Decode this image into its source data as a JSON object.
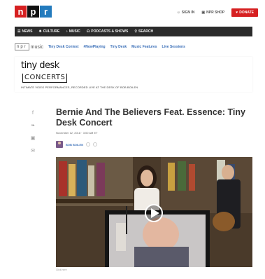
{
  "header": {
    "logo": [
      "n",
      "p",
      "r"
    ],
    "links": [
      {
        "label": "SIGN IN",
        "icon": "user-icon"
      },
      {
        "label": "NPR SHOP",
        "icon": "shop-icon"
      }
    ],
    "donate_label": "DONATE"
  },
  "nav": {
    "items": [
      {
        "label": "NEWS",
        "icon": "menu-icon"
      },
      {
        "label": "CULTURE",
        "icon": "culture-icon"
      },
      {
        "label": "MUSIC",
        "icon": "music-icon"
      },
      {
        "label": "PODCASTS & SHOWS",
        "icon": "headphones-icon"
      },
      {
        "label": "SEARCH",
        "icon": "search-icon"
      }
    ]
  },
  "music_bar": {
    "logo_npr": "npr",
    "logo_music": "music",
    "links": [
      "Tiny Desk Contest",
      "#NowPlaying",
      "Tiny Desk",
      "Music Features",
      "Live Sessions"
    ]
  },
  "series": {
    "logo_top": "tiny desk",
    "logo_bottom": "CONCERTS",
    "description": "INTIMATE VIDEO PERFORMANCES, RECORDED LIVE AT THE DESK OF BOB BOILEN"
  },
  "article": {
    "headline": "Bernie And The Believers Feat. Essence: Tiny Desk Concert",
    "date": "November 12, 2018 · 3:00 AM ET",
    "author": "BOB BOILEN",
    "share_icons": [
      "facebook-icon",
      "twitter-icon",
      "flipboard-icon",
      "email-icon"
    ],
    "caption": "Click here"
  },
  "colors": {
    "npr_red": "#d62021",
    "npr_blue": "#237bbd",
    "nav_bg": "#2b2b2b",
    "link_blue": "#3a6fb8"
  }
}
